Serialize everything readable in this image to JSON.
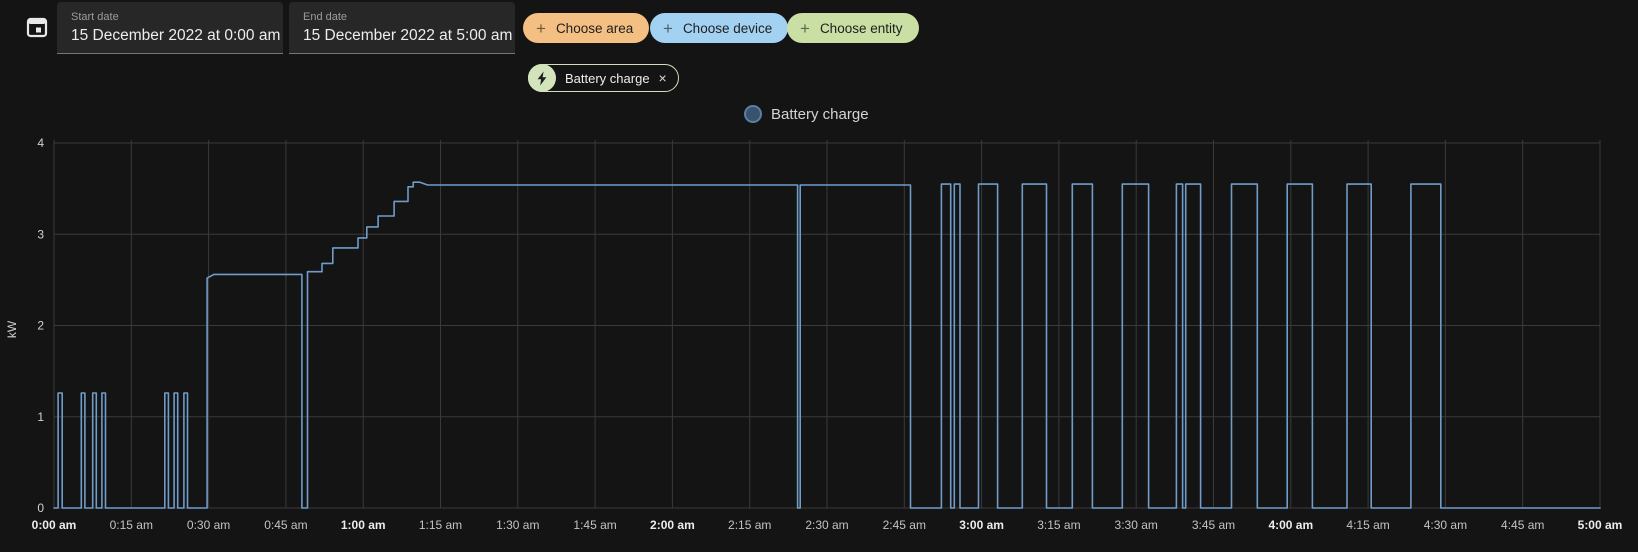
{
  "toolbar": {
    "calendar_icon": "calendar-icon",
    "start_date": {
      "label": "Start date",
      "value": "15 December 2022 at 0:00 am"
    },
    "end_date": {
      "label": "End date",
      "value": "15 December 2022 at 5:00 am"
    },
    "plus_icon": "+",
    "buttons": [
      {
        "label": "Choose area",
        "color": "#f4bf82"
      },
      {
        "label": "Choose device",
        "color": "#a3d1f2"
      },
      {
        "label": "Choose entity",
        "color": "#c9dfa4"
      }
    ],
    "filter_chip": {
      "label": "Battery charge",
      "icon": "lightning-bolt-icon",
      "close_icon": "×",
      "border_color": "#cfe0bd",
      "avatar_color": "#d3e4bd"
    }
  },
  "legend": {
    "items": [
      {
        "label": "Battery charge",
        "dot_fill": "#3a536d",
        "dot_border": "#587fa5"
      }
    ]
  },
  "chart_data": {
    "type": "line",
    "title": "",
    "xlabel": "",
    "ylabel": "kW",
    "ylim": [
      0,
      4
    ],
    "xlim_minutes": [
      0,
      300
    ],
    "grid": true,
    "legend_position": "top-center",
    "line_color": "#6f9cc9",
    "grid_color": "#3a3a3a",
    "tick_color": "#c3c3c3",
    "y_ticks": [
      0,
      1,
      2,
      3,
      4
    ],
    "x_ticks": [
      {
        "minute": 0,
        "label": "0:00 am",
        "bold": true
      },
      {
        "minute": 15,
        "label": "0:15 am",
        "bold": false
      },
      {
        "minute": 30,
        "label": "0:30 am",
        "bold": false
      },
      {
        "minute": 45,
        "label": "0:45 am",
        "bold": false
      },
      {
        "minute": 60,
        "label": "1:00 am",
        "bold": true
      },
      {
        "minute": 75,
        "label": "1:15 am",
        "bold": false
      },
      {
        "minute": 90,
        "label": "1:30 am",
        "bold": false
      },
      {
        "minute": 105,
        "label": "1:45 am",
        "bold": false
      },
      {
        "minute": 120,
        "label": "2:00 am",
        "bold": true
      },
      {
        "minute": 135,
        "label": "2:15 am",
        "bold": false
      },
      {
        "minute": 150,
        "label": "2:30 am",
        "bold": false
      },
      {
        "minute": 165,
        "label": "2:45 am",
        "bold": false
      },
      {
        "minute": 180,
        "label": "3:00 am",
        "bold": true
      },
      {
        "minute": 195,
        "label": "3:15 am",
        "bold": false
      },
      {
        "minute": 210,
        "label": "3:30 am",
        "bold": false
      },
      {
        "minute": 225,
        "label": "3:45 am",
        "bold": false
      },
      {
        "minute": 240,
        "label": "4:00 am",
        "bold": true
      },
      {
        "minute": 255,
        "label": "4:15 am",
        "bold": false
      },
      {
        "minute": 270,
        "label": "4:30 am",
        "bold": false
      },
      {
        "minute": 285,
        "label": "4:45 am",
        "bold": false
      },
      {
        "minute": 300,
        "label": "5:00 am",
        "bold": true
      }
    ],
    "series": [
      {
        "name": "Battery charge",
        "color": "#6f9cc9",
        "unit": "kW",
        "points": [
          [
            0,
            0
          ],
          [
            0.8,
            0
          ],
          [
            0.8,
            1.26
          ],
          [
            1.6,
            1.26
          ],
          [
            1.6,
            0
          ],
          [
            5.3,
            0
          ],
          [
            5.3,
            1.26
          ],
          [
            6.0,
            1.26
          ],
          [
            6.0,
            0
          ],
          [
            7.5,
            0
          ],
          [
            7.5,
            1.26
          ],
          [
            8.2,
            1.26
          ],
          [
            8.2,
            0
          ],
          [
            9.3,
            0
          ],
          [
            9.3,
            1.26
          ],
          [
            10.0,
            1.26
          ],
          [
            10.0,
            0
          ],
          [
            21.5,
            0
          ],
          [
            21.5,
            1.26
          ],
          [
            22.2,
            1.26
          ],
          [
            22.2,
            0
          ],
          [
            23.3,
            0
          ],
          [
            23.3,
            1.26
          ],
          [
            24.0,
            1.26
          ],
          [
            24.0,
            0
          ],
          [
            25.2,
            0
          ],
          [
            25.2,
            1.26
          ],
          [
            25.9,
            1.26
          ],
          [
            25.9,
            0
          ],
          [
            29.7,
            0
          ],
          [
            29.7,
            2.52
          ],
          [
            31.0,
            2.56
          ],
          [
            48.1,
            2.56
          ],
          [
            48.1,
            0
          ],
          [
            49.2,
            0
          ],
          [
            49.2,
            2.59
          ],
          [
            52.0,
            2.59
          ],
          [
            52.0,
            2.68
          ],
          [
            54.1,
            2.68
          ],
          [
            54.1,
            2.85
          ],
          [
            59.0,
            2.85
          ],
          [
            59.0,
            2.96
          ],
          [
            60.7,
            2.96
          ],
          [
            60.7,
            3.08
          ],
          [
            62.9,
            3.08
          ],
          [
            62.9,
            3.2
          ],
          [
            66.0,
            3.2
          ],
          [
            66.0,
            3.36
          ],
          [
            68.7,
            3.36
          ],
          [
            68.7,
            3.52
          ],
          [
            69.7,
            3.52
          ],
          [
            69.7,
            3.57
          ],
          [
            71.0,
            3.57
          ],
          [
            72.5,
            3.54
          ],
          [
            144.3,
            3.54
          ],
          [
            144.3,
            0
          ],
          [
            144.8,
            0
          ],
          [
            144.8,
            3.54
          ],
          [
            166.2,
            3.54
          ],
          [
            166.2,
            0
          ],
          [
            172.2,
            0
          ],
          [
            172.2,
            3.55
          ],
          [
            174.0,
            3.55
          ],
          [
            174.0,
            0
          ],
          [
            174.7,
            0
          ],
          [
            174.7,
            3.55
          ],
          [
            175.8,
            3.55
          ],
          [
            175.8,
            0
          ],
          [
            179.4,
            0
          ],
          [
            179.4,
            3.55
          ],
          [
            183.1,
            3.55
          ],
          [
            183.1,
            0
          ],
          [
            187.9,
            0
          ],
          [
            187.9,
            3.55
          ],
          [
            192.6,
            3.55
          ],
          [
            192.6,
            0
          ],
          [
            197.6,
            0
          ],
          [
            197.6,
            3.55
          ],
          [
            201.5,
            3.55
          ],
          [
            201.5,
            0
          ],
          [
            207.3,
            0
          ],
          [
            207.3,
            3.55
          ],
          [
            212.4,
            3.55
          ],
          [
            212.4,
            0
          ],
          [
            217.8,
            0
          ],
          [
            217.8,
            3.55
          ],
          [
            219.0,
            3.55
          ],
          [
            219.0,
            0
          ],
          [
            219.6,
            0
          ],
          [
            219.6,
            3.55
          ],
          [
            222.5,
            3.55
          ],
          [
            222.5,
            0
          ],
          [
            228.5,
            0
          ],
          [
            228.5,
            3.55
          ],
          [
            233.5,
            3.55
          ],
          [
            233.5,
            0
          ],
          [
            239.3,
            0
          ],
          [
            239.3,
            3.55
          ],
          [
            244.2,
            3.55
          ],
          [
            244.2,
            0
          ],
          [
            250.9,
            0
          ],
          [
            250.9,
            3.55
          ],
          [
            255.6,
            3.55
          ],
          [
            255.6,
            0
          ],
          [
            263.3,
            0
          ],
          [
            263.3,
            3.55
          ],
          [
            269.1,
            3.55
          ],
          [
            269.1,
            0
          ],
          [
            300,
            0
          ]
        ]
      }
    ]
  }
}
